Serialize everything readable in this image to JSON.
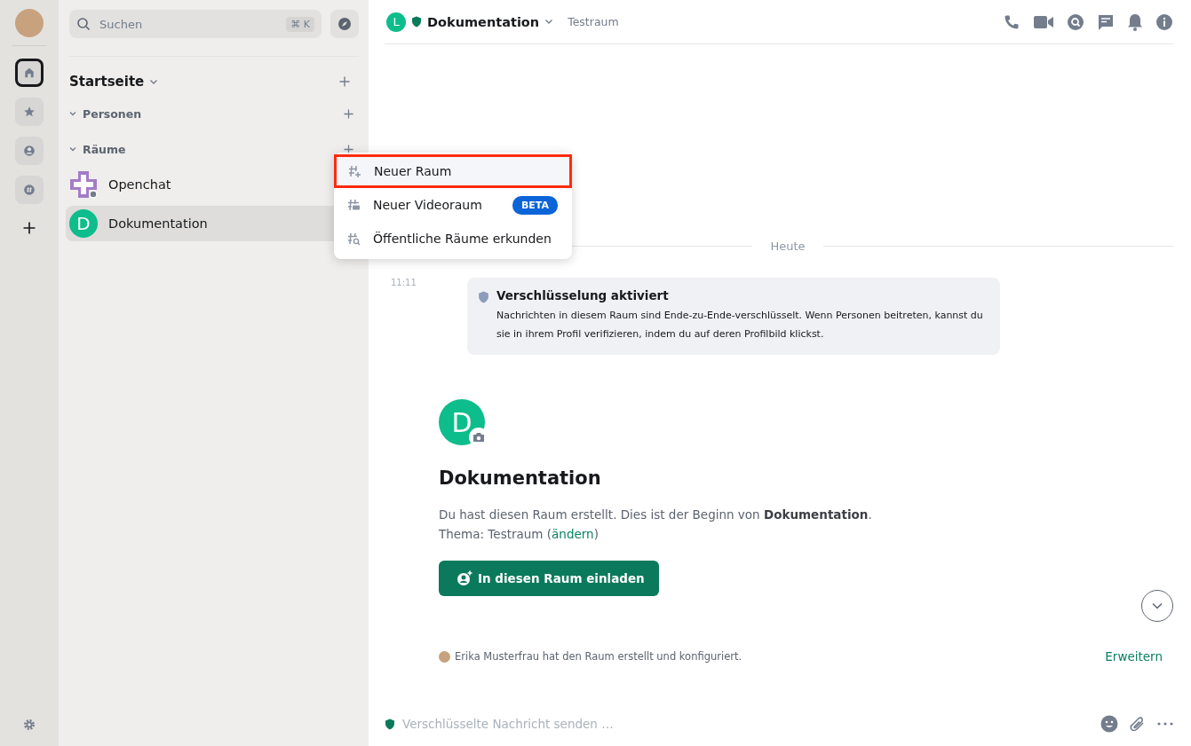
{
  "space_bar": {
    "items": [
      {
        "kind": "home",
        "selected": true
      },
      {
        "kind": "favourites",
        "selected": false
      },
      {
        "kind": "people",
        "selected": false
      },
      {
        "kind": "rooms",
        "selected": false
      }
    ]
  },
  "sidebar": {
    "search": {
      "placeholder": "Suchen",
      "shortcut": "⌘ K"
    },
    "title": "Startseite",
    "sections": [
      {
        "label": "Personen",
        "expanded": true
      },
      {
        "label": "Räume",
        "expanded": true,
        "rooms": [
          {
            "name": "Openchat",
            "kind": "image",
            "selected": false
          },
          {
            "name": "Dokumentation",
            "kind": "letter",
            "letter": "D",
            "selected": true
          }
        ]
      }
    ]
  },
  "menu": {
    "items": [
      {
        "kind": "new-room",
        "label": "Neuer Raum",
        "highlighted": true
      },
      {
        "kind": "video-room",
        "label": "Neuer Videoraum",
        "badge": "BETA",
        "highlighted": false
      },
      {
        "kind": "explore",
        "label": "Öffentliche Räume erkunden",
        "highlighted": false
      }
    ]
  },
  "header": {
    "avatar_letter": "L",
    "title": "Dokumentation",
    "topic": "Testraum"
  },
  "timeline": {
    "date_separator": "Heute",
    "time": "11:11",
    "notice": {
      "title": "Verschlüsselung aktiviert",
      "body": "Nachrichten in diesem Raum sind Ende-zu-Ende-verschlüsselt. Wenn Personen beitreten, kannst du sie in ihrem Profil verifizieren, indem du auf deren Profilbild klickst."
    },
    "room_intro": {
      "avatar_letter": "D",
      "name": "Dokumentation",
      "text": "Du hast diesen Raum erstellt. Dies ist der Beginn von **Dokumentation**.",
      "topic_prefix": "Thema: Testraum (",
      "topic_link": "ändern",
      "topic_suffix": ")",
      "invite_button": "In diesen Raum einladen"
    },
    "summary": {
      "text": "Erika Musterfrau hat den Raum erstellt und konfiguriert.",
      "link": "Erweitern"
    }
  },
  "composer": {
    "placeholder": "Verschlüsselte Nachricht senden …"
  }
}
